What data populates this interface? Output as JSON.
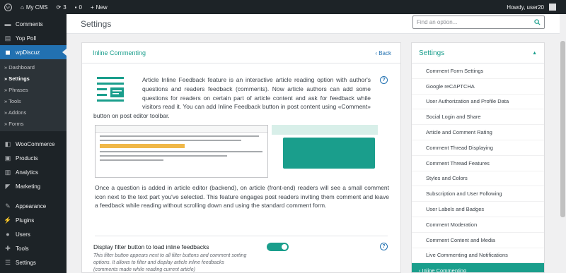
{
  "adminbar": {
    "site_name": "My CMS",
    "updates_count": "3",
    "comments_count": "0",
    "new_label": "New",
    "howdy": "Howdy, user20"
  },
  "sidebar": {
    "top_items": [
      {
        "label": "Comments",
        "icon": "comment-icon"
      },
      {
        "label": "Yop Poll",
        "icon": "poll-icon"
      },
      {
        "label": "wpDiscuz",
        "icon": "discuz-icon"
      }
    ],
    "submenu": [
      "» Dashboard",
      "» Settings",
      "» Phrases",
      "» Tools",
      "» Addons",
      "» Forms"
    ],
    "bottom_items": [
      {
        "label": "WooCommerce",
        "icon": "woo-icon"
      },
      {
        "label": "Products",
        "icon": "products-icon"
      },
      {
        "label": "Analytics",
        "icon": "analytics-icon"
      },
      {
        "label": "Marketing",
        "icon": "marketing-icon"
      },
      {
        "label": "Appearance",
        "icon": "appearance-icon"
      },
      {
        "label": "Plugins",
        "icon": "plugins-icon"
      },
      {
        "label": "Users",
        "icon": "users-icon"
      },
      {
        "label": "Tools",
        "icon": "tools-icon"
      },
      {
        "label": "Settings",
        "icon": "settings-icon"
      }
    ]
  },
  "header": {
    "title": "Settings",
    "search_placeholder": "Find an option..."
  },
  "main": {
    "title": "Inline Commenting",
    "back_label": "‹ Back",
    "description": "Article Inline Feedback feature is an interactive article reading option with author's questions and readers feedback (comments). Now article authors can add some questions for readers on certain part of article content and ask for feedback while visitors read it. You can add Inline Feedback button in post content using «Comment» button on post editor toolbar.",
    "description2": "Once a question is added in article editor (backend), on article (front-end) readers will see a small comment icon next to the text part you've selected. This feature engages post readers inviting them comment and leave a feedback while reading without scrolling down and using the standard comment form.",
    "option_title": "Display filter button to load inline feedbacks",
    "option_desc": "This filter button appears next to all filter buttons and comment sorting options. It allows to filter and display article inline feedbacks (comments made while reading current article)",
    "option_enabled": true
  },
  "settings_nav": {
    "title": "Settings",
    "items": [
      "Comment Form Settings",
      "Google reCAPTCHA",
      "User Authorization and Profile Data",
      "Social Login and Share",
      "Article and Comment Rating",
      "Comment Thread Displaying",
      "Comment Thread Features",
      "Styles and Colors",
      "Subscription and User Following",
      "User Labels and Badges",
      "Comment Moderation",
      "Comment Content and Media",
      "Live Commenting and Notifications"
    ],
    "active_item": "‹ Inline Commenting"
  },
  "colors": {
    "accent": "#1a9e8c",
    "admin_dark": "#1d2327",
    "admin_blue": "#2271b1"
  }
}
